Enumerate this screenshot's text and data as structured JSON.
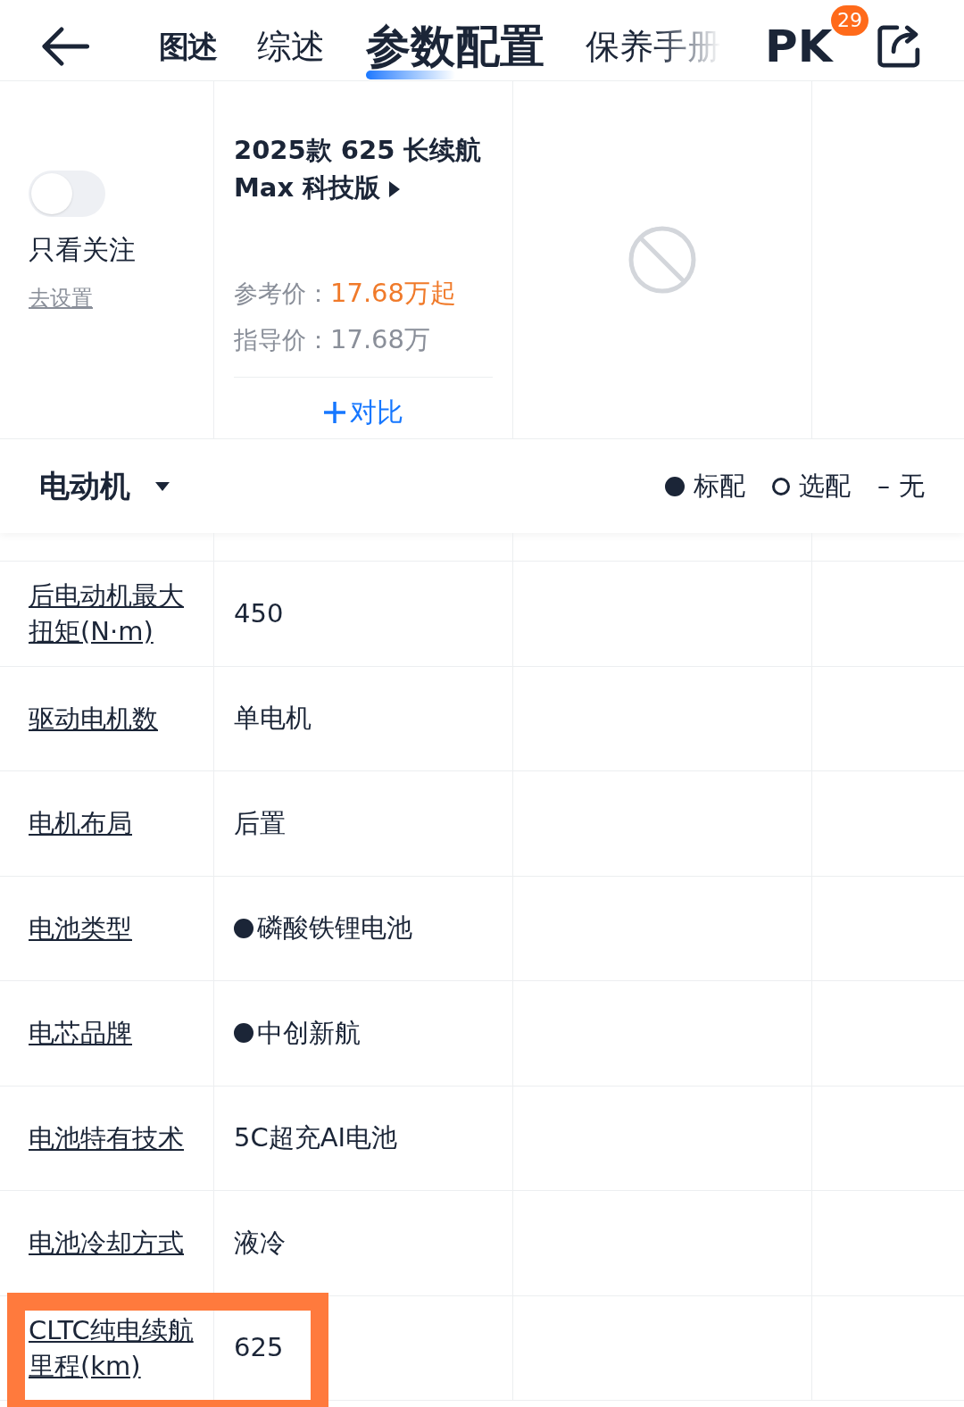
{
  "nav": {
    "tabs": [
      {
        "label": "图述",
        "selected": false,
        "kind": "logo"
      },
      {
        "label": "综述",
        "selected": false,
        "kind": "text"
      },
      {
        "label": "参数配置",
        "selected": true,
        "kind": "text"
      },
      {
        "label": "保养手册",
        "selected": false,
        "kind": "faded"
      }
    ],
    "pk": {
      "label": "PK",
      "badge": "29"
    }
  },
  "filter": {
    "on": false,
    "label": "只看关注",
    "link": "去设置"
  },
  "car": {
    "name": "2025款 625 长续航 Max 科技版",
    "ref_label": "参考价：",
    "ref_price": "17.68万起",
    "guide_label": "指导价：",
    "guide_price": "17.68万",
    "compare": "对比"
  },
  "section": {
    "title": "电动机",
    "legend": [
      {
        "kind": "standard",
        "label": "标配"
      },
      {
        "kind": "optional",
        "label": "选配"
      },
      {
        "kind": "none",
        "label": "无",
        "symbol": "–"
      }
    ]
  },
  "rows": [
    {
      "name": "后电动机最大扭矩(N·m)",
      "value": "450",
      "standard": false,
      "highlighted": false
    },
    {
      "name": "驱动电机数",
      "value": "单电机",
      "standard": false,
      "highlighted": false
    },
    {
      "name": "电机布局",
      "value": "后置",
      "standard": false,
      "highlighted": false
    },
    {
      "name": "电池类型",
      "value": "磷酸铁锂电池",
      "standard": true,
      "highlighted": false
    },
    {
      "name": "电芯品牌",
      "value": "中创新航",
      "standard": true,
      "highlighted": false
    },
    {
      "name": "电池特有技术",
      "value": "5C超充AI电池",
      "standard": false,
      "highlighted": false
    },
    {
      "name": "电池冷却方式",
      "value": "液冷",
      "standard": false,
      "highlighted": false
    },
    {
      "name": "CLTC纯电续航里程(km)",
      "value": "625",
      "standard": false,
      "highlighted": true
    }
  ]
}
